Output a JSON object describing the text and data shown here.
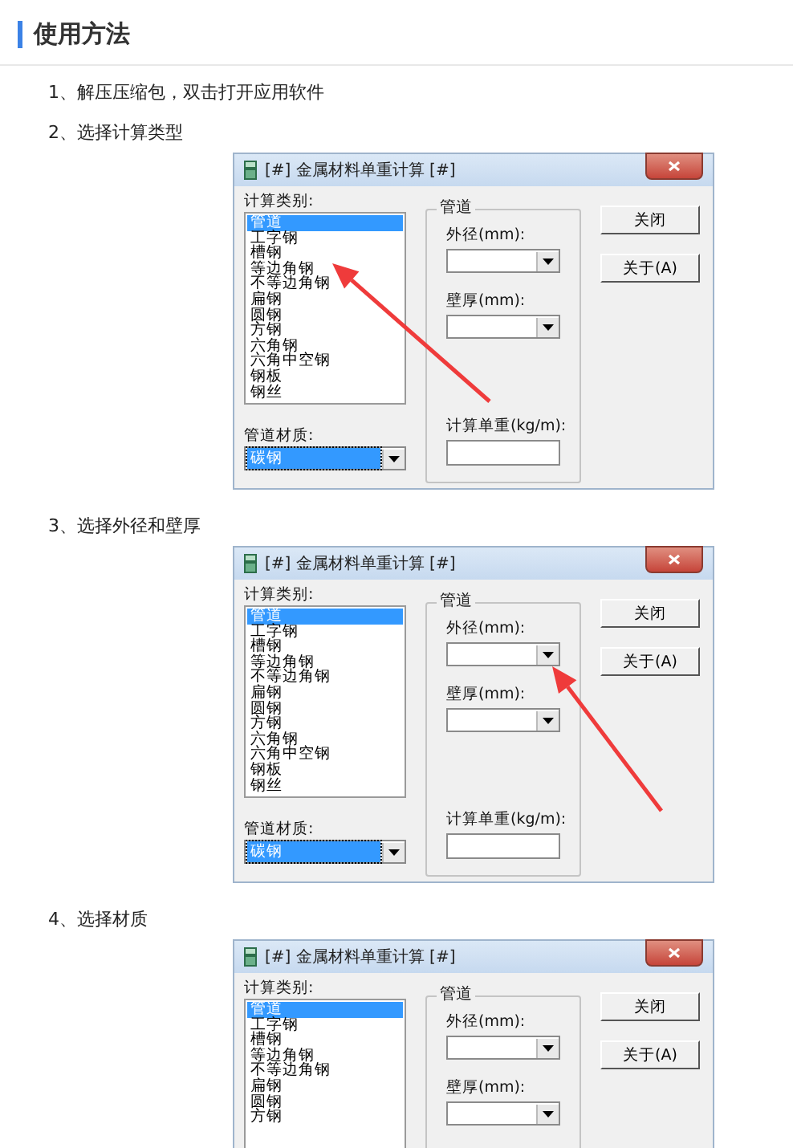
{
  "heading": "使用方法",
  "steps": [
    {
      "text": "1、解压压缩包，双击打开应用软件"
    },
    {
      "text": "2、选择计算类型",
      "window": {
        "title": "[#] 金属材料单重计算 [#]",
        "category_label": "计算类别:",
        "categories": [
          {
            "label": "管道",
            "selected": true
          },
          {
            "label": "工字钢",
            "selected": false
          },
          {
            "label": "槽钢",
            "selected": false
          },
          {
            "label": "等边角钢",
            "selected": false
          },
          {
            "label": "不等边角钢",
            "selected": false
          },
          {
            "label": "扁钢",
            "selected": false
          },
          {
            "label": "圆钢",
            "selected": false
          },
          {
            "label": "方钢",
            "selected": false
          },
          {
            "label": "六角钢",
            "selected": false
          },
          {
            "label": "六角中空钢",
            "selected": false
          },
          {
            "label": "钢板",
            "selected": false
          },
          {
            "label": "钢丝",
            "selected": false
          }
        ],
        "material_label": "管道材质:",
        "material": "碳钢",
        "group_title": "管道",
        "outer_label": "外径(mm):",
        "wall_label": "壁厚(mm):",
        "result_label": "计算单重(kg/m):",
        "buttons": [
          "关闭",
          "关于(A)"
        ],
        "arrow": {
          "kind": "list"
        }
      }
    },
    {
      "text": "3、选择外径和壁厚",
      "window": {
        "title": "[#] 金属材料单重计算 [#]",
        "category_label": "计算类别:",
        "categories": [
          {
            "label": "管道",
            "selected": true
          },
          {
            "label": "工字钢",
            "selected": false
          },
          {
            "label": "槽钢",
            "selected": false
          },
          {
            "label": "等边角钢",
            "selected": false
          },
          {
            "label": "不等边角钢",
            "selected": false
          },
          {
            "label": "扁钢",
            "selected": false
          },
          {
            "label": "圆钢",
            "selected": false
          },
          {
            "label": "方钢",
            "selected": false
          },
          {
            "label": "六角钢",
            "selected": false
          },
          {
            "label": "六角中空钢",
            "selected": false
          },
          {
            "label": "钢板",
            "selected": false
          },
          {
            "label": "钢丝",
            "selected": false
          }
        ],
        "material_label": "管道材质:",
        "material": "碳钢",
        "group_title": "管道",
        "outer_label": "外径(mm):",
        "wall_label": "壁厚(mm):",
        "result_label": "计算单重(kg/m):",
        "buttons": [
          "关闭",
          "关于(A)"
        ],
        "arrow": {
          "kind": "combo"
        }
      }
    },
    {
      "text": "4、选择材质",
      "window": {
        "title": "[#] 金属材料单重计算 [#]",
        "category_label": "计算类别:",
        "categories": [
          {
            "label": "管道",
            "selected": true
          },
          {
            "label": "工字钢",
            "selected": false
          },
          {
            "label": "槽钢",
            "selected": false
          },
          {
            "label": "等边角钢",
            "selected": false
          },
          {
            "label": "不等边角钢",
            "selected": false
          },
          {
            "label": "扁钢",
            "selected": false
          },
          {
            "label": "圆钢",
            "selected": false
          },
          {
            "label": "方钢",
            "selected": false
          }
        ],
        "group_title": "管道",
        "outer_label": "外径(mm):",
        "wall_label": "壁厚(mm):",
        "buttons": [
          "关闭",
          "关于(A)"
        ]
      }
    }
  ]
}
